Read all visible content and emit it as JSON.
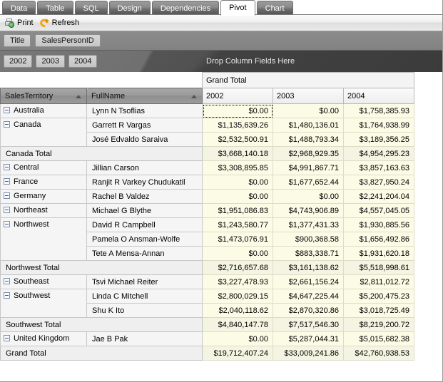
{
  "tabs": [
    {
      "label": "Data",
      "active": false
    },
    {
      "label": "Table",
      "active": false
    },
    {
      "label": "SQL",
      "active": false
    },
    {
      "label": "Design",
      "active": false
    },
    {
      "label": "Dependencies",
      "active": false
    },
    {
      "label": "Pivot",
      "active": true
    },
    {
      "label": "Chart",
      "active": false
    }
  ],
  "toolbar": {
    "print_label": "Print",
    "refresh_label": "Refresh"
  },
  "page_fields": [
    "Title",
    "SalesPersonID"
  ],
  "year_filters": [
    "2002",
    "2003",
    "2004"
  ],
  "drop_column_hint": "Drop Column Fields Here",
  "column_group": "Grand Total",
  "columns": [
    "2002",
    "2003",
    "2004"
  ],
  "row_headers": [
    "SalesTerritory",
    "FullName"
  ],
  "sort_indicator": "ascending",
  "rows": [
    {
      "kind": "data",
      "territory": "Australia",
      "name": "Lynn N Tsoflias",
      "values": [
        "$0.00",
        "$0.00",
        "$1,758,385.93"
      ],
      "selected": true,
      "territory_span": 1
    },
    {
      "kind": "data",
      "territory": "Canada",
      "name": "Garrett R Vargas",
      "values": [
        "$1,135,639.26",
        "$1,480,136.01",
        "$1,764,938.99"
      ],
      "territory_span": 2
    },
    {
      "kind": "data",
      "territory": null,
      "name": "José Edvaldo Saraiva",
      "values": [
        "$2,532,500.91",
        "$1,488,793.34",
        "$3,189,356.25"
      ]
    },
    {
      "kind": "total",
      "label": "Canada Total",
      "values": [
        "$3,668,140.18",
        "$2,968,929.35",
        "$4,954,295.23"
      ]
    },
    {
      "kind": "data",
      "territory": "Central",
      "name": "Jillian  Carson",
      "values": [
        "$3,308,895.85",
        "$4,991,867.71",
        "$3,857,163.63"
      ],
      "territory_span": 1
    },
    {
      "kind": "data",
      "territory": "France",
      "name": "Ranjit R Varkey Chudukatil",
      "values": [
        "$0.00",
        "$1,677,652.44",
        "$3,827,950.24"
      ],
      "territory_span": 1
    },
    {
      "kind": "data",
      "territory": "Germany",
      "name": "Rachel B Valdez",
      "values": [
        "$0.00",
        "$0.00",
        "$2,241,204.04"
      ],
      "territory_span": 1
    },
    {
      "kind": "data",
      "territory": "Northeast",
      "name": "Michael G Blythe",
      "values": [
        "$1,951,086.83",
        "$4,743,906.89",
        "$4,557,045.05"
      ],
      "territory_span": 1
    },
    {
      "kind": "data",
      "territory": "Northwest",
      "name": "David R Campbell",
      "values": [
        "$1,243,580.77",
        "$1,377,431.33",
        "$1,930,885.56"
      ],
      "territory_span": 3
    },
    {
      "kind": "data",
      "territory": null,
      "name": "Pamela O Ansman-Wolfe",
      "values": [
        "$1,473,076.91",
        "$900,368.58",
        "$1,656,492.86"
      ]
    },
    {
      "kind": "data",
      "territory": null,
      "name": "Tete A Mensa-Annan",
      "values": [
        "$0.00",
        "$883,338.71",
        "$1,931,620.18"
      ]
    },
    {
      "kind": "total",
      "label": "Northwest Total",
      "values": [
        "$2,716,657.68",
        "$3,161,138.62",
        "$5,518,998.61"
      ]
    },
    {
      "kind": "data",
      "territory": "Southeast",
      "name": "Tsvi Michael Reiter",
      "values": [
        "$3,227,478.93",
        "$2,661,156.24",
        "$2,811,012.72"
      ],
      "territory_span": 1
    },
    {
      "kind": "data",
      "territory": "Southwest",
      "name": "Linda C Mitchell",
      "values": [
        "$2,800,029.15",
        "$4,647,225.44",
        "$5,200,475.23"
      ],
      "territory_span": 2
    },
    {
      "kind": "data",
      "territory": null,
      "name": "Shu K Ito",
      "values": [
        "$2,040,118.62",
        "$2,870,320.86",
        "$3,018,725.49"
      ]
    },
    {
      "kind": "total",
      "label": "Southwest Total",
      "values": [
        "$4,840,147.78",
        "$7,517,546.30",
        "$8,219,200.72"
      ]
    },
    {
      "kind": "data",
      "territory": "United Kingdom",
      "name": "Jae B Pak",
      "values": [
        "$0.00",
        "$5,287,044.31",
        "$5,015,682.38"
      ],
      "territory_span": 1
    },
    {
      "kind": "total",
      "label": "Grand Total",
      "values": [
        "$19,712,407.24",
        "$33,009,241.86",
        "$42,760,938.53"
      ]
    }
  ],
  "colors": {
    "value_cell_bg": "#fbfbe6",
    "header_bg": "#9b9b9b",
    "band_bg": "#4b4b4b",
    "active_tab_bg": "#ffffff"
  }
}
